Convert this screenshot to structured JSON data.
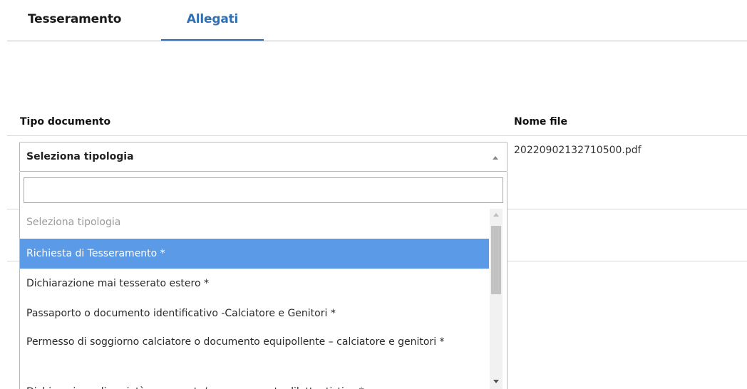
{
  "tabs": [
    {
      "label": "Tesseramento",
      "active": false
    },
    {
      "label": "Allegati",
      "active": true
    }
  ],
  "table": {
    "columns": [
      "Tipo documento",
      "Nome file"
    ],
    "row": {
      "file_name": "20220902132710500.pdf"
    }
  },
  "select": {
    "value": "Seleziona tipologia",
    "search_value": "",
    "search_placeholder": "",
    "options": [
      "Seleziona tipologia",
      "Richiesta di Tesseramento *",
      "Dichiarazione mai tesserato estero *",
      "Passaporto o documento identificativo -Calciatore e Genitori *",
      "Permesso di soggiorno calciatore o documento equipollente – calciatore e genitori *",
      "Dichiarazione di società puramente/non puramente dilettantistica *"
    ],
    "highlighted_index": 1
  },
  "colors": {
    "accent": "#2f6fb3",
    "highlight": "#5b9ae6"
  }
}
